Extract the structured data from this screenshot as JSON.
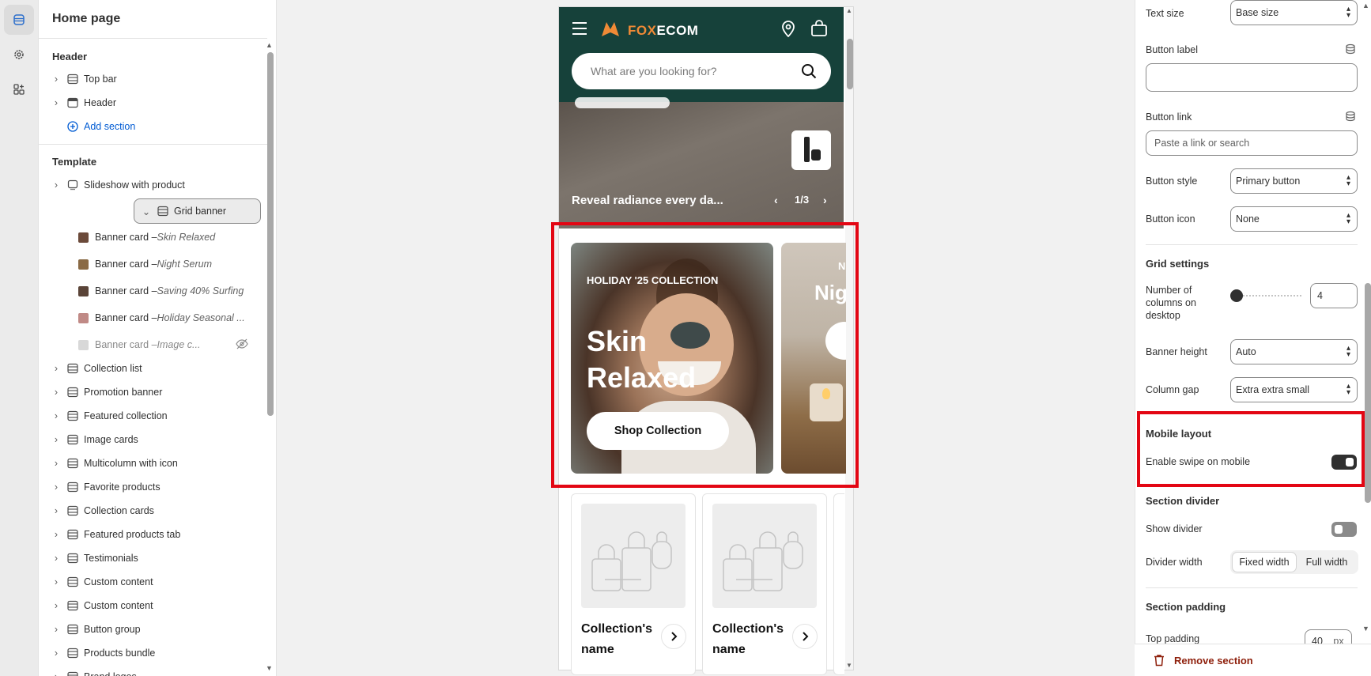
{
  "rail": {
    "icons": [
      "sections-icon",
      "settings-gear-icon",
      "apps-icon"
    ]
  },
  "sidebar": {
    "title": "Home page",
    "header_group": "Header",
    "header_items": [
      {
        "label": "Top bar",
        "icon": "section-icon"
      },
      {
        "label": "Header",
        "icon": "header-icon"
      }
    ],
    "add_section": "Add section",
    "template_group": "Template",
    "slideshow": "Slideshow with product",
    "grid_banner": "Grid banner",
    "banner_cards": [
      {
        "prefix": "Banner card – ",
        "name": "Skin Relaxed",
        "thumb": "#6b4a3a"
      },
      {
        "prefix": "Banner card – ",
        "name": "Night Serum",
        "thumb": "#8a6a45"
      },
      {
        "prefix": "Banner card – ",
        "name": "Saving 40% Surfing",
        "thumb": "#5a4438"
      },
      {
        "prefix": "Banner card – ",
        "name": "Holiday Seasonal ...",
        "thumb": "#c08a86"
      },
      {
        "prefix": "Banner card – ",
        "name": "Image c...",
        "thumb": "#d8d8d8"
      }
    ],
    "sections": [
      "Collection list",
      "Promotion banner",
      "Featured collection",
      "Image cards",
      "Multicolumn with icon",
      "Favorite products",
      "Collection cards",
      "Featured products tab",
      "Testimonials",
      "Custom content",
      "Custom content",
      "Button group",
      "Products bundle",
      "Brand logos"
    ]
  },
  "preview": {
    "logo_prefix": "FOX",
    "logo_suffix": "ECOM",
    "search_placeholder": "What are you looking for?",
    "hero_text": "Reveal radiance every da...",
    "hero_counter": "1/3",
    "card1": {
      "eyebrow": "HOLIDAY '25 COLLECTION",
      "title": "Skin Relaxed",
      "button": "Shop Collection"
    },
    "card2": {
      "eyebrow": "N",
      "title": "Nig"
    },
    "collections": [
      {
        "name": "Collection's name"
      },
      {
        "name": "Collection's name"
      }
    ]
  },
  "panel": {
    "text_size_label": "Text size",
    "text_size_value": "Base size",
    "button_label_label": "Button label",
    "button_label_value": "",
    "button_link_label": "Button link",
    "button_link_placeholder": "Paste a link or search",
    "button_style_label": "Button style",
    "button_style_value": "Primary button",
    "button_icon_label": "Button icon",
    "button_icon_value": "None",
    "grid_settings": "Grid settings",
    "columns_label": "Number of columns on desktop",
    "columns_value": "4",
    "columns_slider_level": 0,
    "banner_height_label": "Banner height",
    "banner_height_value": "Auto",
    "column_gap_label": "Column gap",
    "column_gap_value": "Extra extra small",
    "mobile_layout": "Mobile layout",
    "swipe_label": "Enable swipe on mobile",
    "swipe_on": true,
    "section_divider": "Section divider",
    "show_divider_label": "Show divider",
    "show_divider_on": false,
    "divider_width_label": "Divider width",
    "divider_width_options": [
      "Fixed width",
      "Full width"
    ],
    "divider_width_selected": "Fixed width",
    "section_padding": "Section padding",
    "top_padding_label": "Top padding",
    "top_padding_value": "40",
    "top_padding_unit": "px",
    "remove_section": "Remove section"
  },
  "colors": {
    "accent_red": "#e30613",
    "header_green": "#16413a",
    "link_blue": "#005bd3",
    "remove_red": "#8e1f0b",
    "logo_orange": "#f08a36"
  }
}
